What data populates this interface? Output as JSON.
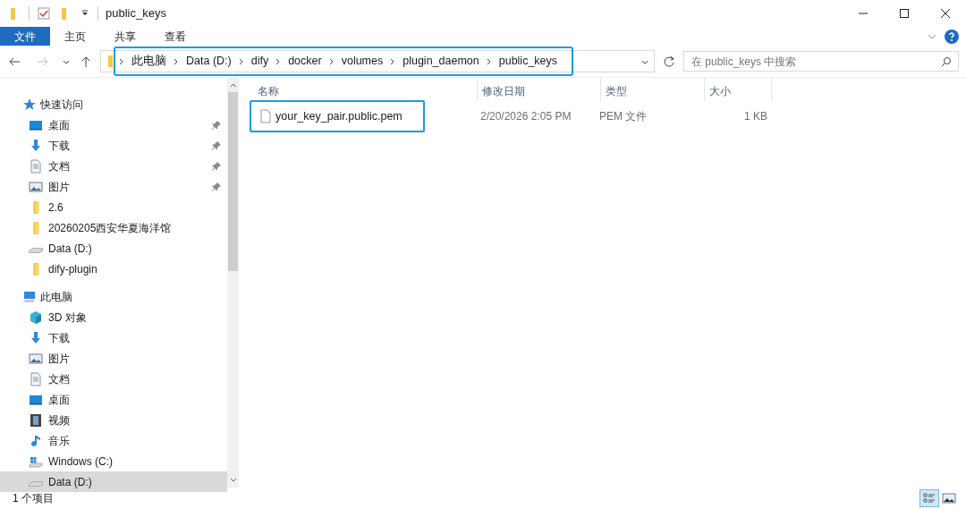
{
  "window": {
    "title": "public_keys"
  },
  "ribbon_tabs": [
    {
      "label": "文件",
      "selected": true
    },
    {
      "label": "主页",
      "selected": false
    },
    {
      "label": "共享",
      "selected": false
    },
    {
      "label": "查看",
      "selected": false
    }
  ],
  "address_bar": {
    "highlighted": true,
    "crumbs": [
      "此电脑",
      "Data (D:)",
      "dify",
      "docker",
      "volumes",
      "plugin_daemon",
      "public_keys"
    ]
  },
  "search": {
    "placeholder": "在 public_keys 中搜索"
  },
  "sidebar": {
    "items": [
      {
        "label": "快速访问",
        "kind": "star",
        "children": [
          {
            "label": "桌面",
            "kind": "desktop",
            "pinned": true,
            "selected": false
          },
          {
            "label": "下载",
            "kind": "download",
            "pinned": true,
            "selected": false
          },
          {
            "label": "文档",
            "kind": "document",
            "pinned": true,
            "selected": false
          },
          {
            "label": "图片",
            "kind": "picture",
            "pinned": true,
            "selected": false
          },
          {
            "label": "2.6",
            "kind": "folder",
            "pinned": false,
            "selected": false
          },
          {
            "label": "20260205西安华夏海洋馆",
            "kind": "folder",
            "pinned": false,
            "selected": false
          },
          {
            "label": "Data (D:)",
            "kind": "drive",
            "pinned": false,
            "selected": false
          },
          {
            "label": "dify-plugin",
            "kind": "folder",
            "pinned": false,
            "selected": false
          }
        ]
      },
      {
        "label": "此电脑",
        "kind": "pc",
        "children": [
          {
            "label": "3D 对象",
            "kind": "cube",
            "pinned": false,
            "selected": false
          },
          {
            "label": "下载",
            "kind": "download",
            "pinned": false,
            "selected": false
          },
          {
            "label": "图片",
            "kind": "picture",
            "pinned": false,
            "selected": false
          },
          {
            "label": "文档",
            "kind": "document",
            "pinned": false,
            "selected": false
          },
          {
            "label": "桌面",
            "kind": "desktop",
            "pinned": false,
            "selected": false
          },
          {
            "label": "视频",
            "kind": "video",
            "pinned": false,
            "selected": false
          },
          {
            "label": "音乐",
            "kind": "music",
            "pinned": false,
            "selected": false
          },
          {
            "label": "Windows (C:)",
            "kind": "windows-drive",
            "pinned": false,
            "selected": false
          },
          {
            "label": "Data (D:)",
            "kind": "drive",
            "pinned": false,
            "selected": true
          }
        ]
      }
    ]
  },
  "file_list": {
    "columns": [
      "名称",
      "修改日期",
      "类型",
      "大小"
    ],
    "rows": [
      {
        "name": "your_key_pair.public.pem",
        "modified": "2/20/2026 2:05 PM",
        "type": "PEM 文件",
        "size": "1 KB",
        "highlighted": true
      }
    ]
  },
  "status_bar": {
    "text": "1 个项目",
    "views": [
      {
        "kind": "details",
        "selected": true
      },
      {
        "kind": "thumbnails",
        "selected": false
      }
    ]
  }
}
